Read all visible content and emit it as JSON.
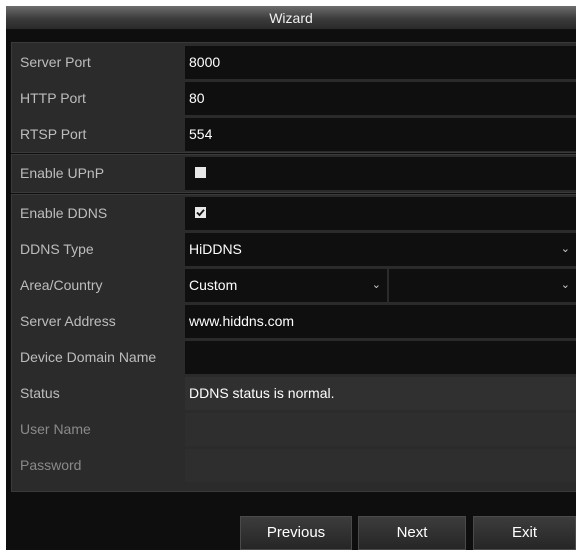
{
  "window": {
    "title": "Wizard"
  },
  "network": {
    "server_port": {
      "label": "Server Port",
      "value": "8000"
    },
    "http_port": {
      "label": "HTTP Port",
      "value": "80"
    },
    "rtsp_port": {
      "label": "RTSP Port",
      "value": "554"
    }
  },
  "upnp": {
    "label": "Enable UPnP",
    "checked": false
  },
  "ddns": {
    "enable": {
      "label": "Enable DDNS",
      "checked": true
    },
    "type": {
      "label": "DDNS Type",
      "value": "HiDDNS"
    },
    "area": {
      "label": "Area/Country",
      "value": "Custom",
      "secondary_value": ""
    },
    "server_address": {
      "label": "Server Address",
      "value": "www.hiddns.com"
    },
    "device_domain": {
      "label": "Device Domain Name",
      "value": ""
    },
    "status": {
      "label": "Status",
      "value": "DDNS status is normal."
    },
    "user_name": {
      "label": "User Name",
      "value": ""
    },
    "password": {
      "label": "Password",
      "value": ""
    }
  },
  "buttons": {
    "previous": "Previous",
    "next": "Next",
    "exit": "Exit"
  },
  "icons": {
    "checkbox_checked": "checkmark-icon",
    "dropdown": "chevron-down-icon"
  },
  "colors": {
    "background": "#0e0e0e",
    "row": "#2b2b2b",
    "field": "#0f0f0f",
    "label_text": "#bdbdbd"
  }
}
